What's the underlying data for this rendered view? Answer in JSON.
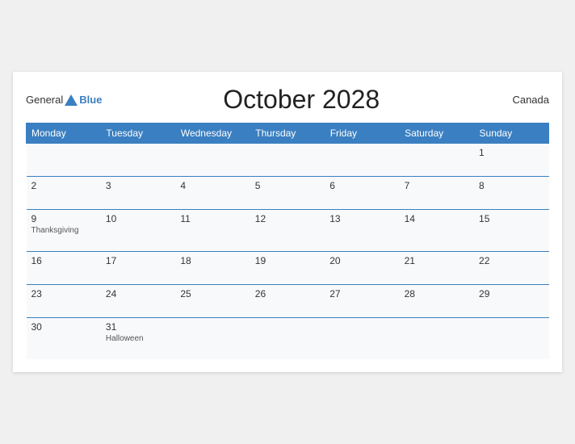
{
  "header": {
    "logo_general": "General",
    "logo_blue": "Blue",
    "title": "October 2028",
    "country": "Canada"
  },
  "days_of_week": [
    "Monday",
    "Tuesday",
    "Wednesday",
    "Thursday",
    "Friday",
    "Saturday",
    "Sunday"
  ],
  "weeks": [
    [
      {
        "day": "",
        "event": ""
      },
      {
        "day": "",
        "event": ""
      },
      {
        "day": "",
        "event": ""
      },
      {
        "day": "",
        "event": ""
      },
      {
        "day": "",
        "event": ""
      },
      {
        "day": "",
        "event": ""
      },
      {
        "day": "1",
        "event": ""
      }
    ],
    [
      {
        "day": "2",
        "event": ""
      },
      {
        "day": "3",
        "event": ""
      },
      {
        "day": "4",
        "event": ""
      },
      {
        "day": "5",
        "event": ""
      },
      {
        "day": "6",
        "event": ""
      },
      {
        "day": "7",
        "event": ""
      },
      {
        "day": "8",
        "event": ""
      }
    ],
    [
      {
        "day": "9",
        "event": "Thanksgiving"
      },
      {
        "day": "10",
        "event": ""
      },
      {
        "day": "11",
        "event": ""
      },
      {
        "day": "12",
        "event": ""
      },
      {
        "day": "13",
        "event": ""
      },
      {
        "day": "14",
        "event": ""
      },
      {
        "day": "15",
        "event": ""
      }
    ],
    [
      {
        "day": "16",
        "event": ""
      },
      {
        "day": "17",
        "event": ""
      },
      {
        "day": "18",
        "event": ""
      },
      {
        "day": "19",
        "event": ""
      },
      {
        "day": "20",
        "event": ""
      },
      {
        "day": "21",
        "event": ""
      },
      {
        "day": "22",
        "event": ""
      }
    ],
    [
      {
        "day": "23",
        "event": ""
      },
      {
        "day": "24",
        "event": ""
      },
      {
        "day": "25",
        "event": ""
      },
      {
        "day": "26",
        "event": ""
      },
      {
        "day": "27",
        "event": ""
      },
      {
        "day": "28",
        "event": ""
      },
      {
        "day": "29",
        "event": ""
      }
    ],
    [
      {
        "day": "30",
        "event": ""
      },
      {
        "day": "31",
        "event": "Halloween"
      },
      {
        "day": "",
        "event": ""
      },
      {
        "day": "",
        "event": ""
      },
      {
        "day": "",
        "event": ""
      },
      {
        "day": "",
        "event": ""
      },
      {
        "day": "",
        "event": ""
      }
    ]
  ]
}
